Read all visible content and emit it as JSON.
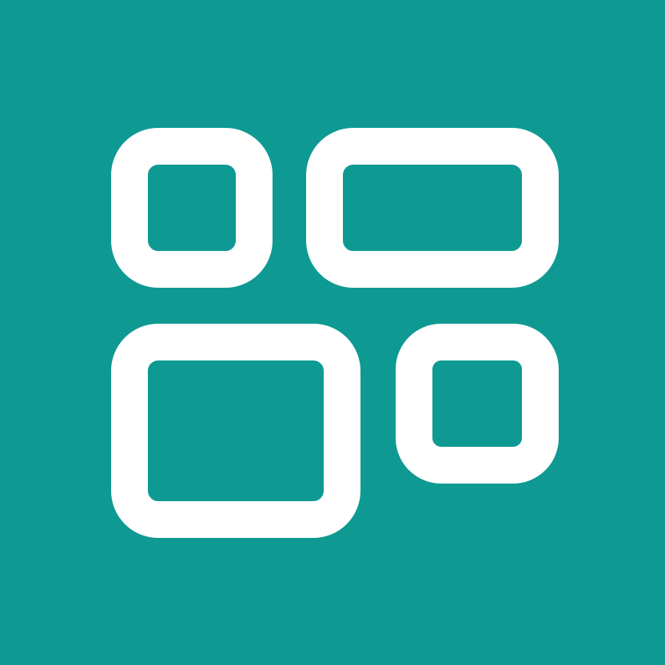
{
  "icon": {
    "name": "dashboard-tiles-icon",
    "background_color": "#0E9A93",
    "glyph_color": "#FFFFFF"
  }
}
